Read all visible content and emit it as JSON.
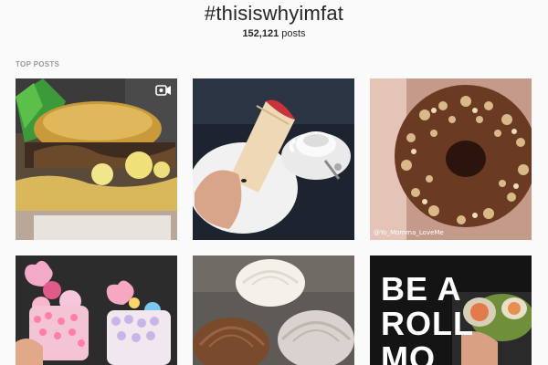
{
  "hashtag": "#thisiswhyimfat",
  "post_count": {
    "number": "152,121",
    "unit": "posts"
  },
  "section_label": "TOP POSTS",
  "posts": [
    {
      "subject": "burger",
      "has_video_icon": true
    },
    {
      "subject": "wrap-and-coffee"
    },
    {
      "subject": "nut-donut",
      "watermark": "@Yo_Momma_LoveMe"
    },
    {
      "subject": "candy-freakshakes"
    },
    {
      "subject": "frosted-cupcakes"
    },
    {
      "subject": "be-a-roll-sign",
      "sign_lines": [
        "BE A",
        "ROLL",
        "MO"
      ]
    }
  ],
  "icons": {
    "video": "video-camera-icon"
  }
}
